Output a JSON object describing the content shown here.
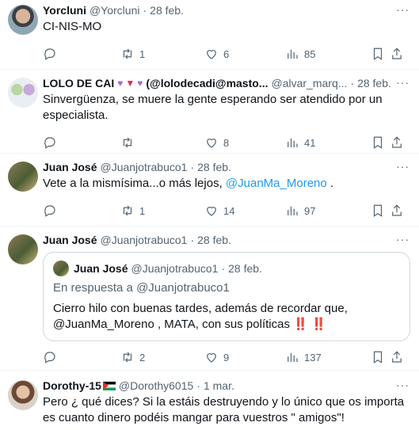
{
  "tweets": [
    {
      "name": "Yorcluni",
      "handle": "@Yorcluni",
      "time": "28 feb.",
      "text": "CI-NIS-MO",
      "stats": {
        "retweets": "1",
        "likes": "6",
        "views": "85"
      }
    },
    {
      "name": "LOLO DE CAI",
      "name_rest": "(@lolodecadi@masto...",
      "handle": "@alvar_marq...",
      "time": "28 feb.",
      "text": "Sinvergüenza, se muere la gente esperando ser atendido por un especialista.",
      "stats": {
        "retweets": "",
        "likes": "8",
        "views": "41"
      }
    },
    {
      "name": "Juan José",
      "handle": "@Juanjotrabuco1",
      "time": "28 feb.",
      "text_before": "Vete a la mismísima...o más lejos, ",
      "mention": "@JuanMa_Moreno",
      "text_after": " .",
      "stats": {
        "retweets": "1",
        "likes": "14",
        "views": "97"
      }
    },
    {
      "name": "Juan José",
      "handle": "@Juanjotrabuco1",
      "time": "28 feb.",
      "quote": {
        "name": "Juan José",
        "handle": "@Juanjotrabuco1",
        "time": "28 feb.",
        "reply_to": "En respuesta a @Juanjotrabuco1",
        "text": "Cierro hilo con buenas tardes, además de recordar que, @JuanMa_Moreno , MATA, con sus políticas",
        "emoji": "‼️ ‼️"
      },
      "stats": {
        "retweets": "2",
        "likes": "9",
        "views": "137"
      }
    },
    {
      "name": "Dorothy-15",
      "handle": "@Dorothy6015",
      "time": "1 mar.",
      "text": "Pero ¿ qué dices? Si la estáis destruyendo y lo único que os importa es cuanto dinero podéis mangar para vuestros \" amigos\"!"
    }
  ],
  "dot": "·",
  "more": "···",
  "colors": {
    "accent": "#1d9bf0",
    "muted": "#536471",
    "text": "#0f1419",
    "divider": "#eff3f4"
  },
  "icons": [
    "reply-icon",
    "retweet-icon",
    "like-icon",
    "views-icon",
    "bookmark-icon",
    "share-icon",
    "more-icon"
  ]
}
